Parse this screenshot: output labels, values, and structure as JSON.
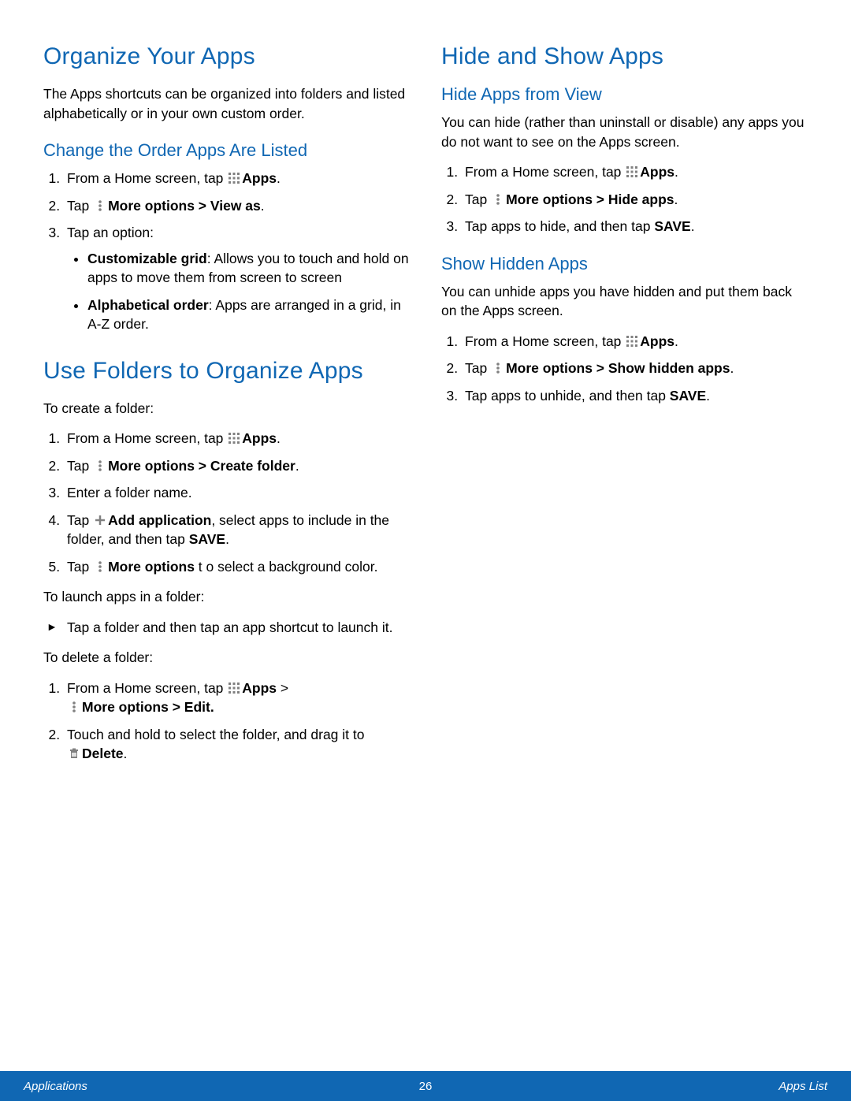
{
  "left": {
    "h1a": "Organize Your Apps",
    "intro": "The Apps shortcuts can be organized into folders and listed alphabetically or in your own custom order.",
    "h2a": "Change the Order Apps Are Listed",
    "order": {
      "s1a": "From a Home screen, tap ",
      "s1b": "Apps",
      "s1c": ".",
      "s2a": "Tap ",
      "s2b": "More options > View as",
      "s2c": ".",
      "s3": "Tap an option:",
      "opt1a": "Customizable grid",
      "opt1b": ": Allows you to touch and hold on apps to move them from screen to screen",
      "opt2a": "Alphabetical order",
      "opt2b": ": Apps are arranged in a grid, in A-Z order."
    },
    "h1b": "Use Folders to Organize Apps",
    "create_label": "To create a folder:",
    "create": {
      "s1a": "From a Home screen, tap ",
      "s1b": "Apps",
      "s1c": ".",
      "s2a": "Tap ",
      "s2b": "More options > Create folder",
      "s2c": ".",
      "s3": "Enter a folder name.",
      "s4a": "Tap ",
      "s4b": "Add application",
      "s4c": ", select apps to include in the folder, and then tap ",
      "s4d": "SAVE",
      "s4e": ".",
      "s5a": "Tap ",
      "s5b": "More options",
      "s5c": " t o select a background color."
    },
    "launch_label": "To launch apps in a folder:",
    "launch_item": "Tap a folder and then tap an app shortcut to launch it.",
    "delete_label": "To delete a folder:",
    "delete": {
      "s1a": "From a Home screen, tap ",
      "s1b": "Apps",
      "s1c": " > ",
      "s1d": "More options > Edit.",
      "s2a": "Touch and hold to select the folder, and drag it to ",
      "s2b": "Delete",
      "s2c": "."
    }
  },
  "right": {
    "h1": "Hide and Show Apps",
    "h2a": "Hide Apps from View",
    "hide_intro": "You can hide (rather than uninstall or disable) any apps you do not want to see on the Apps screen.",
    "hide": {
      "s1a": "From a Home screen, tap ",
      "s1b": "Apps",
      "s1c": ".",
      "s2a": "Tap ",
      "s2b": "More options > Hide apps",
      "s2c": ".",
      "s3a": "Tap apps to hide, and then tap ",
      "s3b": "SAVE",
      "s3c": "."
    },
    "h2b": "Show Hidden Apps",
    "show_intro": "You can unhide apps you have hidden and put them back on the Apps screen.",
    "show": {
      "s1a": "From a Home screen, tap ",
      "s1b": "Apps",
      "s1c": ".",
      "s2a": "Tap ",
      "s2b": "More options > Show hidden apps",
      "s2c": ".",
      "s3a": "Tap apps to unhide, and then tap ",
      "s3b": "SAVE",
      "s3c": "."
    }
  },
  "footer": {
    "left": "Applications",
    "center": "26",
    "right": "Apps List"
  }
}
